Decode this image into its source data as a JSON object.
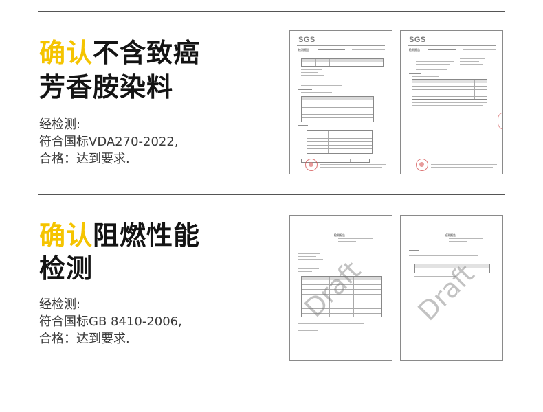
{
  "section1": {
    "title_highlight": "确认",
    "title_rest": "不含致癌",
    "title_line2": "芳香胺染料",
    "desc_line1": "经检测:",
    "desc_line2": "符合国标VDA270-2022,",
    "desc_line3": "合格：达到要求."
  },
  "section2": {
    "title_highlight": "确认",
    "title_rest": "阻燃性能",
    "title_line2": "检测",
    "desc_line1": "经检测:",
    "desc_line2": "符合国标GB 8410-2006,",
    "desc_line3": "合格：达到要求."
  },
  "reports": {
    "sgs_logo": "SGS",
    "report_title": "检测报告",
    "watermark": "Draft"
  },
  "colors": {
    "highlight": "#f5c400",
    "stamp": "#d24a4a"
  }
}
